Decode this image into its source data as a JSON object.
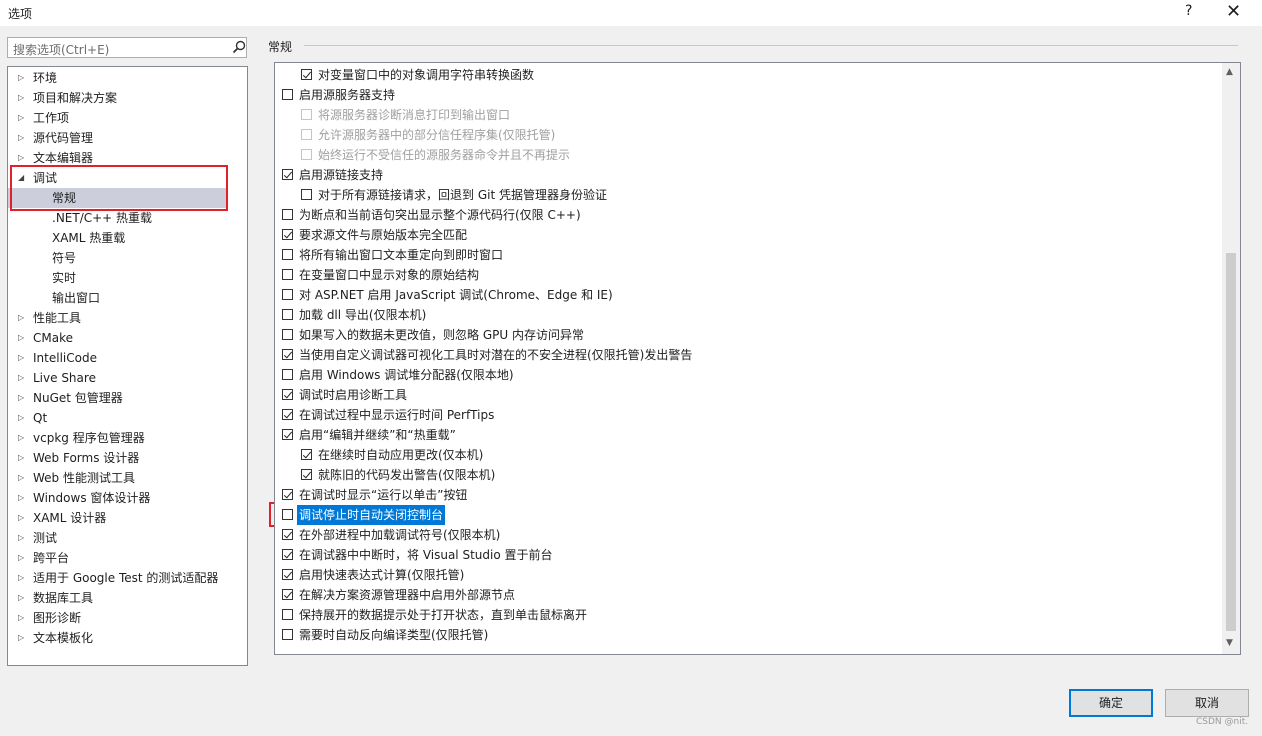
{
  "window": {
    "title": "选项",
    "help": "?",
    "close": "✕"
  },
  "search": {
    "placeholder": "搜索选项(Ctrl+E)"
  },
  "tree": {
    "items": [
      {
        "label": "环境",
        "expand": "right"
      },
      {
        "label": "项目和解决方案",
        "expand": "right"
      },
      {
        "label": "工作项",
        "expand": "right"
      },
      {
        "label": "源代码管理",
        "expand": "right"
      },
      {
        "label": "文本编辑器",
        "expand": "right"
      },
      {
        "label": "调试",
        "expand": "down"
      },
      {
        "label": "常规",
        "expand": "none",
        "selected": true
      },
      {
        "label": ".NET/C++ 热重载",
        "expand": "none"
      },
      {
        "label": "XAML 热重载",
        "expand": "none"
      },
      {
        "label": "符号",
        "expand": "none"
      },
      {
        "label": "实时",
        "expand": "none"
      },
      {
        "label": "输出窗口",
        "expand": "none"
      },
      {
        "label": "性能工具",
        "expand": "right"
      },
      {
        "label": "CMake",
        "expand": "right"
      },
      {
        "label": "IntelliCode",
        "expand": "right"
      },
      {
        "label": "Live Share",
        "expand": "right"
      },
      {
        "label": "NuGet 包管理器",
        "expand": "right"
      },
      {
        "label": "Qt",
        "expand": "right"
      },
      {
        "label": "vcpkg 程序包管理器",
        "expand": "right"
      },
      {
        "label": "Web Forms 设计器",
        "expand": "right"
      },
      {
        "label": "Web 性能测试工具",
        "expand": "right"
      },
      {
        "label": "Windows 窗体设计器",
        "expand": "right"
      },
      {
        "label": "XAML 设计器",
        "expand": "right"
      },
      {
        "label": "测试",
        "expand": "right"
      },
      {
        "label": "跨平台",
        "expand": "right"
      },
      {
        "label": "适用于 Google Test 的测试适配器",
        "expand": "right"
      },
      {
        "label": "数据库工具",
        "expand": "right"
      },
      {
        "label": "图形诊断",
        "expand": "right"
      },
      {
        "label": "文本模板化",
        "expand": "right"
      }
    ]
  },
  "section": {
    "title": "常规"
  },
  "options": [
    {
      "label": "对变量窗口中的对象调用字符串转换函数",
      "checked": true,
      "indent": 1,
      "disabled": false
    },
    {
      "label": "启用源服务器支持",
      "checked": false,
      "indent": 0,
      "disabled": false
    },
    {
      "label": "将源服务器诊断消息打印到输出窗口",
      "checked": false,
      "indent": 1,
      "disabled": true
    },
    {
      "label": "允许源服务器中的部分信任程序集(仅限托管)",
      "checked": false,
      "indent": 1,
      "disabled": true
    },
    {
      "label": "始终运行不受信任的源服务器命令并且不再提示",
      "checked": false,
      "indent": 1,
      "disabled": true
    },
    {
      "label": "启用源链接支持",
      "checked": true,
      "indent": 0,
      "disabled": false
    },
    {
      "label": "对于所有源链接请求，回退到 Git 凭据管理器身份验证",
      "checked": false,
      "indent": 1,
      "disabled": false
    },
    {
      "label": "为断点和当前语句突出显示整个源代码行(仅限 C++)",
      "checked": false,
      "indent": 0,
      "disabled": false
    },
    {
      "label": "要求源文件与原始版本完全匹配",
      "checked": true,
      "indent": 0,
      "disabled": false
    },
    {
      "label": "将所有输出窗口文本重定向到即时窗口",
      "checked": false,
      "indent": 0,
      "disabled": false
    },
    {
      "label": "在变量窗口中显示对象的原始结构",
      "checked": false,
      "indent": 0,
      "disabled": false
    },
    {
      "label": "对 ASP.NET 启用 JavaScript 调试(Chrome、Edge 和 IE)",
      "checked": false,
      "indent": 0,
      "disabled": false
    },
    {
      "label": "加载 dll 导出(仅限本机)",
      "checked": false,
      "indent": 0,
      "disabled": false
    },
    {
      "label": "如果写入的数据未更改值，则忽略 GPU 内存访问异常",
      "checked": false,
      "indent": 0,
      "disabled": false
    },
    {
      "label": "当使用自定义调试器可视化工具时对潜在的不安全进程(仅限托管)发出警告",
      "checked": true,
      "indent": 0,
      "disabled": false
    },
    {
      "label": "启用 Windows 调试堆分配器(仅限本地)",
      "checked": false,
      "indent": 0,
      "disabled": false
    },
    {
      "label": "调试时启用诊断工具",
      "checked": true,
      "indent": 0,
      "disabled": false
    },
    {
      "label": "在调试过程中显示运行时间 PerfTips",
      "checked": true,
      "indent": 0,
      "disabled": false
    },
    {
      "label": "启用“编辑并继续”和“热重载”",
      "checked": true,
      "indent": 0,
      "disabled": false
    },
    {
      "label": "在继续时自动应用更改(仅本机)",
      "checked": true,
      "indent": 1,
      "disabled": false
    },
    {
      "label": "就陈旧的代码发出警告(仅限本机)",
      "checked": true,
      "indent": 1,
      "disabled": false
    },
    {
      "label": "在调试时显示“运行以单击”按钮",
      "checked": true,
      "indent": 0,
      "disabled": false
    },
    {
      "label": "调试停止时自动关闭控制台",
      "checked": false,
      "indent": 0,
      "disabled": false,
      "highlighted": true
    },
    {
      "label": "在外部进程中加载调试符号(仅限本机)",
      "checked": true,
      "indent": 0,
      "disabled": false
    },
    {
      "label": "在调试器中中断时，将 Visual Studio 置于前台",
      "checked": true,
      "indent": 0,
      "disabled": false
    },
    {
      "label": "启用快速表达式计算(仅限托管)",
      "checked": true,
      "indent": 0,
      "disabled": false
    },
    {
      "label": "在解决方案资源管理器中启用外部源节点",
      "checked": true,
      "indent": 0,
      "disabled": false
    },
    {
      "label": "保持展开的数据提示处于打开状态，直到单击鼠标离开",
      "checked": false,
      "indent": 0,
      "disabled": false
    },
    {
      "label": "需要时自动反向编译类型(仅限托管)",
      "checked": false,
      "indent": 0,
      "disabled": false
    }
  ],
  "buttons": {
    "ok": "确定",
    "cancel": "取消"
  },
  "watermark": "CSDN @nit.",
  "colors": {
    "highlight": "#0078d7",
    "selected_tree": "#cccedb",
    "annotation_red": "#e0202a"
  }
}
